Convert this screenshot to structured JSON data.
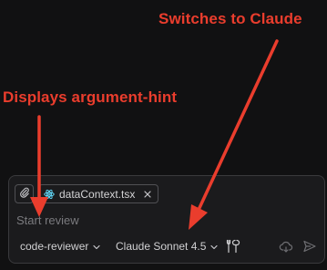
{
  "annotations": {
    "switch_claude": "Switches to Claude",
    "argument_hint": "Displays argument-hint"
  },
  "composer": {
    "attached_file": "dataContext.tsx",
    "placeholder": "Start review",
    "agent_label": "code-reviewer",
    "model_label": "Claude Sonnet 4.5"
  },
  "icons": {
    "attach": "paperclip-icon",
    "file_type": "react-icon",
    "remove": "close-icon",
    "dropdown": "chevron-down-icon",
    "tools": "tools-icon",
    "delegate": "cloud-icon",
    "send": "send-icon"
  },
  "colors": {
    "annotation": "#ea3d2d",
    "react": "#61dafb"
  }
}
